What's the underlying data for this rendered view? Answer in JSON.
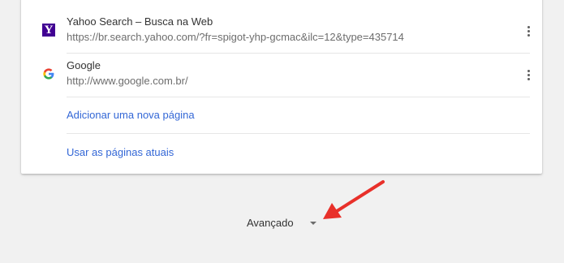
{
  "startup_pages": {
    "pages": [
      {
        "title": "Yahoo Search – Busca na Web",
        "url": "https://br.search.yahoo.com/?fr=spigot-yhp-gcmac&ilc=12&type=435714",
        "favicon_letter": "Y",
        "favicon_color": "#410093"
      },
      {
        "title": "Google",
        "url": "http://www.google.com.br/",
        "favicon_letter": "G",
        "favicon_color": "#4285f4"
      }
    ],
    "add_page_label": "Adicionar uma nova página",
    "use_current_label": "Usar as páginas atuais"
  },
  "advanced": {
    "label": "Avançado"
  },
  "annotation": {
    "arrow_color": "#e8302a"
  }
}
